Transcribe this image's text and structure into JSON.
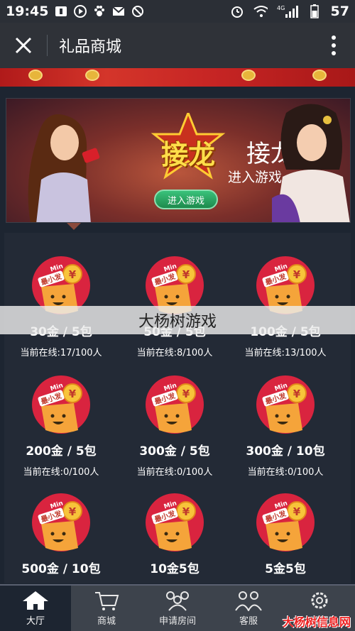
{
  "status_bar": {
    "time": "19:45",
    "network": "4G",
    "battery": "57"
  },
  "title_bar": {
    "title": "礼品商城"
  },
  "banner": {
    "logo_text": "接龙",
    "button_label": "进入游戏",
    "side_title": "接龙",
    "side_subtitle": "进入游戏"
  },
  "icon_badge": {
    "min_text": "Min",
    "label": "最小发",
    "currency": "¥"
  },
  "rooms": [
    {
      "name": "30金 / 5包",
      "online": "当前在线:17/100人"
    },
    {
      "name": "50金 / 5包",
      "online": "当前在线:8/100人"
    },
    {
      "name": "100金 / 5包",
      "online": "当前在线:13/100人"
    },
    {
      "name": "200金 / 5包",
      "online": "当前在线:0/100人"
    },
    {
      "name": "300金 / 5包",
      "online": "当前在线:0/100人"
    },
    {
      "name": "300金 / 10包",
      "online": "当前在线:0/100人"
    },
    {
      "name": "500金 / 10包",
      "online": ""
    },
    {
      "name": "10金5包",
      "online": ""
    },
    {
      "name": "5金5包",
      "online": ""
    }
  ],
  "watermark": "大杨树游戏",
  "bottom_nav": [
    {
      "label": "大厅",
      "icon": "home-icon",
      "active": true
    },
    {
      "label": "商城",
      "icon": "cart-icon",
      "active": false
    },
    {
      "label": "申请房间",
      "icon": "group-icon",
      "active": false
    },
    {
      "label": "客服",
      "icon": "support-icon",
      "active": false
    },
    {
      "label": "设置",
      "icon": "gear-icon",
      "active": false
    }
  ],
  "site_mark": "大杨树信息网",
  "colors": {
    "background": "#1d2531",
    "nav": "#3d434c",
    "badge_red": "#d9243f",
    "badge_orange": "#f5a43a"
  }
}
